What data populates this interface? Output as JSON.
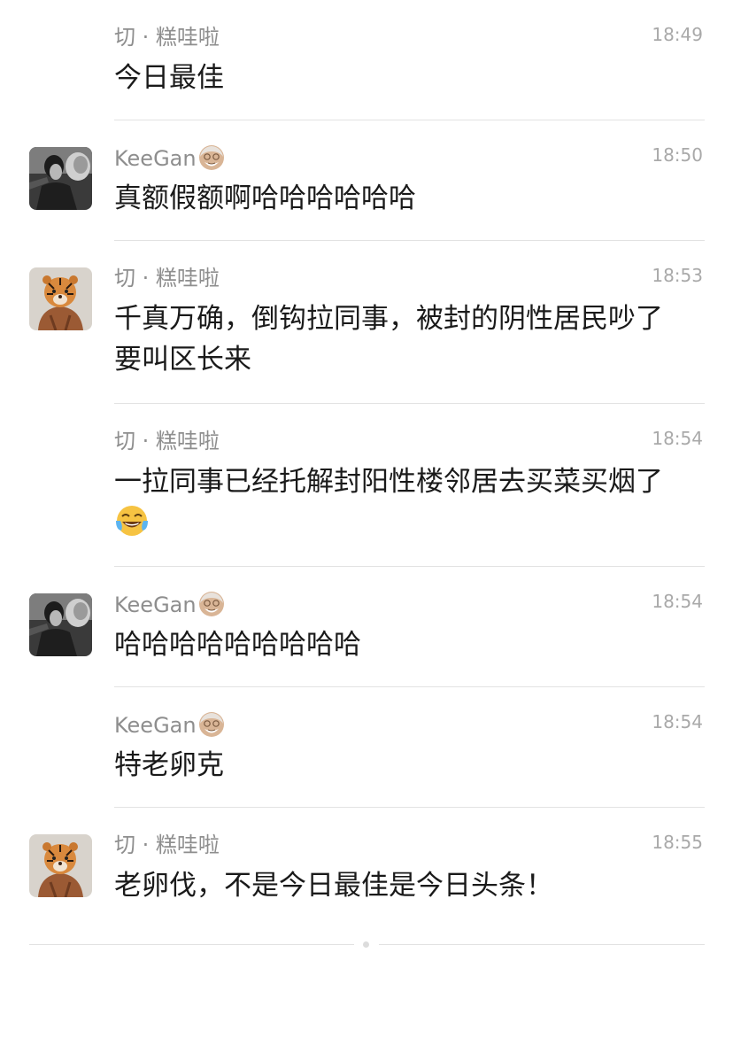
{
  "messages": [
    {
      "sender": "切 · 糕哇啦",
      "time": "18:49",
      "text": "今日最佳",
      "avatar": "none"
    },
    {
      "sender": "KeeGan",
      "sender_icon": "old-man-emoji",
      "time": "18:50",
      "text": "真额假额啊哈哈哈哈哈哈",
      "avatar": "person-photo"
    },
    {
      "sender": "切 · 糕哇啦",
      "time": "18:53",
      "text_lines": [
        "千真万确，倒钩拉同事，被封的阴性居民吵了",
        "要叫区长来"
      ],
      "avatar": "tiger-photo"
    },
    {
      "sender": "切 · 糕哇啦",
      "time": "18:54",
      "text": "一拉同事已经托解封阳性楼邻居去买菜买烟了",
      "emoji": "face-with-tears-of-joy",
      "avatar": "none"
    },
    {
      "sender": "KeeGan",
      "sender_icon": "old-man-emoji",
      "time": "18:54",
      "text": "哈哈哈哈哈哈哈哈哈",
      "avatar": "person-photo"
    },
    {
      "sender": "KeeGan",
      "sender_icon": "old-man-emoji",
      "time": "18:54",
      "text": "特老卵克",
      "avatar": "none"
    },
    {
      "sender": "切 · 糕哇啦",
      "time": "18:55",
      "text": "老卵伐，不是今日最佳是今日头条！",
      "avatar": "tiger-photo"
    }
  ],
  "colors": {
    "sender": "#8e8e8e",
    "time": "#a9a9a9",
    "text": "#1a1a1a",
    "divider": "#e2e2e2"
  }
}
